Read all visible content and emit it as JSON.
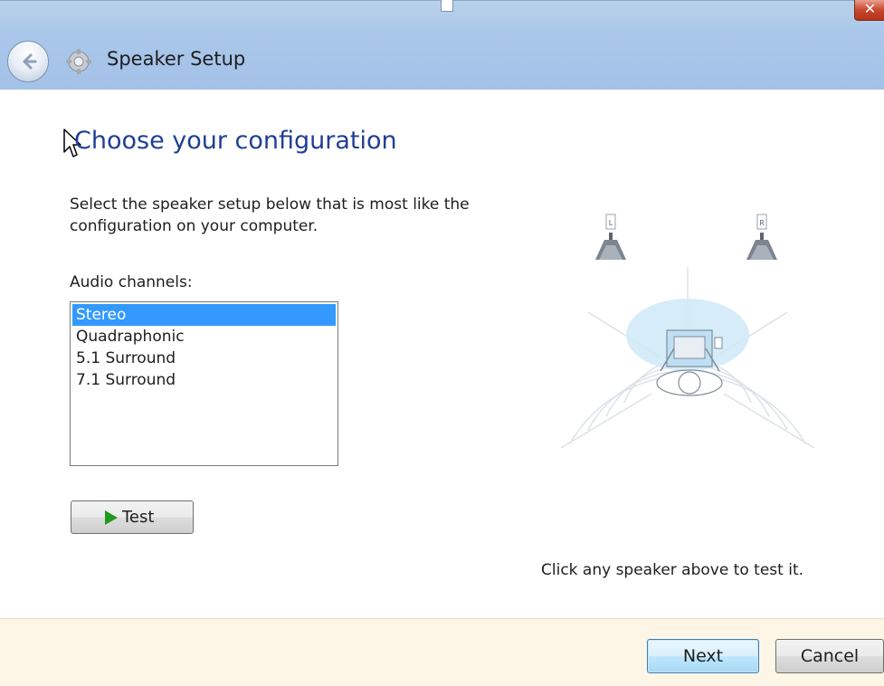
{
  "window": {
    "title": "Speaker Setup",
    "close_glyph": "✕"
  },
  "page": {
    "heading": "Choose your configuration",
    "instructions": "Select the speaker setup below that is most like the configuration on your computer.",
    "channels_label": "Audio channels:",
    "channels": [
      {
        "label": "Stereo",
        "selected": true
      },
      {
        "label": "Quadraphonic",
        "selected": false
      },
      {
        "label": "5.1 Surround",
        "selected": false
      },
      {
        "label": "7.1 Surround",
        "selected": false
      }
    ],
    "test_label": "Test",
    "hint": "Click any speaker above to test it."
  },
  "speakers": {
    "left_label": "L",
    "right_label": "R"
  },
  "footer": {
    "next_label": "Next",
    "cancel_label": "Cancel"
  },
  "icons": {
    "back": "back-arrow-icon",
    "app": "speaker-setup-gear-icon",
    "play": "play-icon"
  },
  "colors": {
    "accent_heading": "#1f3f95",
    "selection": "#3399ff",
    "titlebar": "#a9c7ea",
    "play": "#1f9a1f"
  }
}
